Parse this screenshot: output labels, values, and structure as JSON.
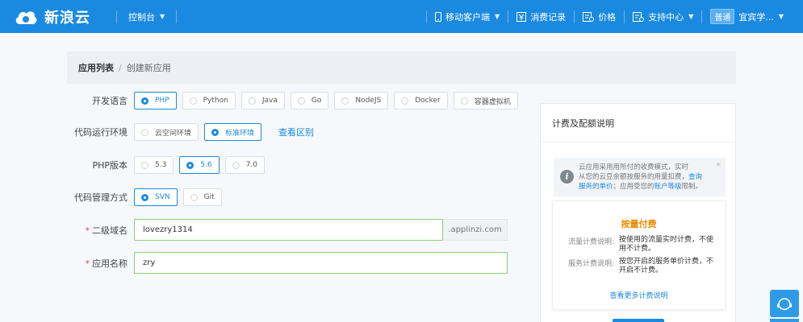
{
  "header": {
    "logo_text": "新浪云",
    "console_label": "控制台",
    "nav": {
      "mobile": "移动客户端",
      "consumption": "消费记录",
      "price": "价格",
      "support": "支持中心",
      "badge": "普通",
      "user": "宜宾学..."
    }
  },
  "breadcrumb": {
    "main": "应用列表",
    "separator": "/",
    "current": "创建新应用"
  },
  "form": {
    "language": {
      "label": "开发语言",
      "options": [
        "PHP",
        "Python",
        "Java",
        "Go",
        "NodeJS",
        "Docker",
        "容器虚拟机"
      ],
      "selected": "PHP"
    },
    "runtime": {
      "label": "代码运行环境",
      "options": [
        "云空间环境",
        "标准环境"
      ],
      "selected": "标准环境",
      "link": "查看区别"
    },
    "php_version": {
      "label": "PHP版本",
      "options": [
        "5.3",
        "5.6",
        "7.0"
      ],
      "selected": "5.6"
    },
    "vcs": {
      "label": "代码管理方式",
      "options": [
        "SVN",
        "Git"
      ],
      "selected": "SVN"
    },
    "subdomain": {
      "required_mark": "*",
      "label": "二级域名",
      "value": "lovezry1314",
      "suffix": ".applinzi.com"
    },
    "app_name": {
      "required_mark": "*",
      "label": "应用名称",
      "value": "zry"
    }
  },
  "panel": {
    "title": "计费及配额说明",
    "notice": {
      "line1": "云应用采用用所付的收费模式，实时",
      "line2a": "从您的云豆余额按服务的用量扣费，",
      "line2b": "查询",
      "line3a": "服务的单价",
      "line3b": "；应用受您的",
      "line3c": "账户等级",
      "line3d": "限制。",
      "close": "×"
    },
    "billing": {
      "title": "按量付费",
      "traffic_key": "流量计费说明:",
      "traffic_value": "按使用的流量实时计费，不使用不计费。",
      "service_key": "服务计费说明:",
      "service_value": "按您开启的服务单价计费，不开启不计费。",
      "link": "查看更多计费说明"
    }
  },
  "colors": {
    "primary": "#1a8ae0",
    "accent": "#f08a00",
    "valid_border": "#8fcf7a"
  }
}
